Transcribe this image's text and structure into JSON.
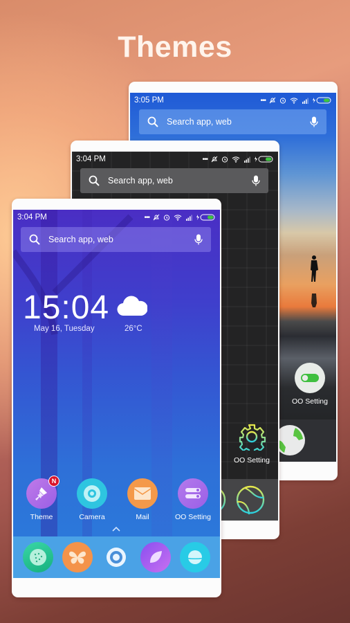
{
  "title": "Themes",
  "phones": {
    "back": {
      "status_time": "3:05 PM",
      "search_placeholder": "Search app, web",
      "app_label": "OO Setting"
    },
    "middle": {
      "status_time": "3:04 PM",
      "search_placeholder": "Search app, web",
      "app_label": "OO Setting"
    },
    "front": {
      "status_time": "3:04 PM",
      "search_placeholder": "Search app, web",
      "clock": "15:04",
      "date": "May 16, Tuesday",
      "temperature": "26°C",
      "weather_icon": "cloud-icon",
      "apps": [
        {
          "label": "Theme",
          "icon": "paint-brush-icon",
          "color": "#b06be8",
          "badge": "N"
        },
        {
          "label": "Camera",
          "icon": "camera-lens-icon",
          "color": "#2ec5e0"
        },
        {
          "label": "Mail",
          "icon": "mail-icon",
          "color": "#f4994a"
        },
        {
          "label": "OO Setting",
          "icon": "toggle-settings-icon",
          "color": "#a666e8"
        }
      ],
      "dock": [
        {
          "icon": "dots-circle-icon",
          "color": "#24c493"
        },
        {
          "icon": "butterfly-icon",
          "color": "#f4934a"
        },
        {
          "icon": "ring-icon",
          "color": "#ffffff"
        },
        {
          "icon": "leaf-icon",
          "color": "#a262f0"
        },
        {
          "icon": "planet-icon",
          "color": "#28cbe6"
        }
      ]
    }
  }
}
